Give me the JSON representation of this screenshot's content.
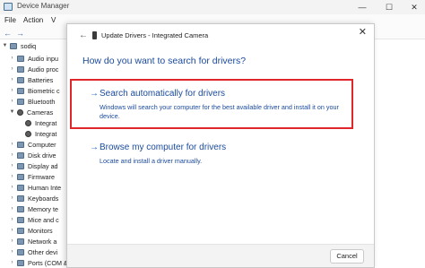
{
  "window": {
    "title": "Device Manager",
    "minimize_glyph": "—",
    "maximize_glyph": "☐",
    "close_glyph": "✕"
  },
  "menu": {
    "file": "File",
    "action": "Action",
    "view": "V"
  },
  "toolbar": {
    "back_glyph": "←",
    "forward_glyph": "→"
  },
  "tree": {
    "root": "sodiq",
    "audio_in": "Audio inpu",
    "audio_proc": "Audio proc",
    "batteries": "Batteries",
    "biometric": "Biometric c",
    "bluetooth": "Bluetooth",
    "cameras": "Cameras",
    "cam1": "Integrat",
    "cam2": "Integrat",
    "computer": "Computer",
    "disk": "Disk drive",
    "display": "Display ad",
    "firmware": "Firmware",
    "hid": "Human Inte",
    "keyboards": "Keyboards",
    "memory": "Memory te",
    "mice": "Mice and c",
    "monitors": "Monitors",
    "network": "Network a",
    "other": "Other devi",
    "ports": "Ports (COM & LPT)"
  },
  "dialog": {
    "close_glyph": "✕",
    "back_glyph": "←",
    "title": "Update Drivers - Integrated Camera",
    "heading": "How do you want to search for drivers?",
    "option_auto": {
      "arrow": "→",
      "title": "Search automatically for drivers",
      "description": "Windows will search your computer for the best available driver and install it on your device."
    },
    "option_browse": {
      "arrow": "→",
      "title": "Browse my computer for drivers",
      "description": "Locate and install a driver manually."
    },
    "cancel_label": "Cancel"
  },
  "colors": {
    "accent": "#1a4a9c",
    "highlight": "#e0262b"
  }
}
